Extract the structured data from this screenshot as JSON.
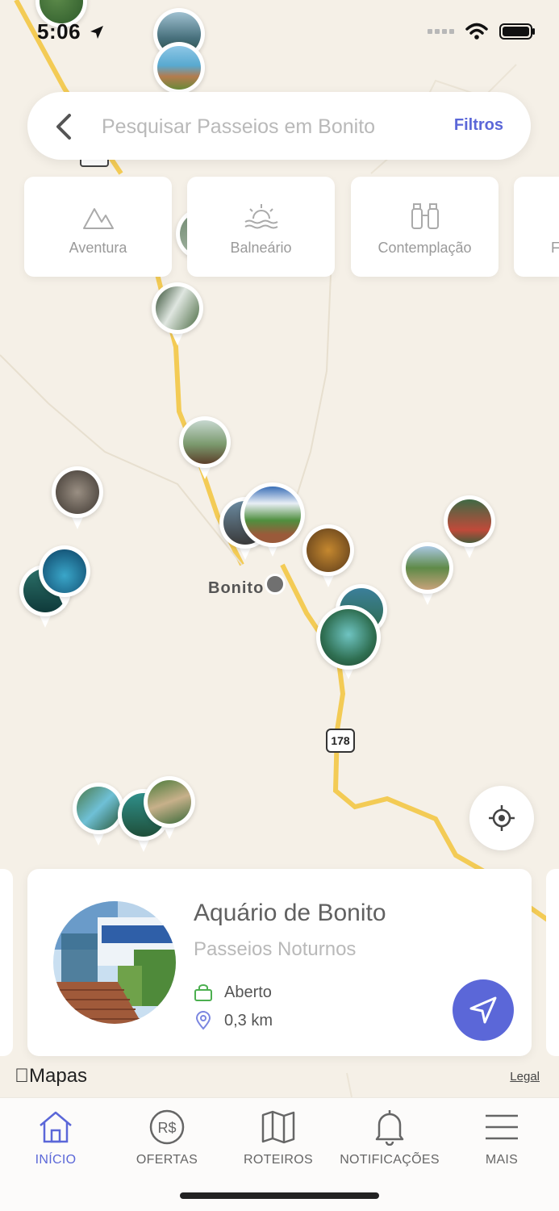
{
  "status": {
    "time": "5:06"
  },
  "search": {
    "placeholder": "Pesquisar Passeios em Bonito",
    "filters_label": "Filtros"
  },
  "categories": [
    {
      "label": "Aventura",
      "icon": "mountain-icon"
    },
    {
      "label": "Balneário",
      "icon": "sunrise-water-icon"
    },
    {
      "label": "Contemplação",
      "icon": "binoculars-icon"
    },
    {
      "label": "F",
      "icon": "category-icon"
    }
  ],
  "map": {
    "city_label": "Bonito",
    "route_number": "178"
  },
  "card": {
    "title": "Aquário de Bonito",
    "subtitle": "Passeios Noturnos",
    "status": "Aberto",
    "distance": "0,3 km"
  },
  "footer": {
    "maps_brand": "Mapas",
    "legal": "Legal"
  },
  "tabs": [
    {
      "label": "INÍCIO",
      "icon": "home-icon",
      "active": true
    },
    {
      "label": "OFERTAS",
      "icon": "currency-icon",
      "active": false
    },
    {
      "label": "ROTEIROS",
      "icon": "map-icon",
      "active": false
    },
    {
      "label": "NOTIFICAÇÕES",
      "icon": "bell-icon",
      "active": false
    },
    {
      "label": "MAIS",
      "icon": "menu-icon",
      "active": false
    }
  ],
  "colors": {
    "accent": "#5b67d8",
    "open_status": "#4caf50",
    "road": "#f2c94c",
    "map_bg": "#f5f0e7"
  }
}
